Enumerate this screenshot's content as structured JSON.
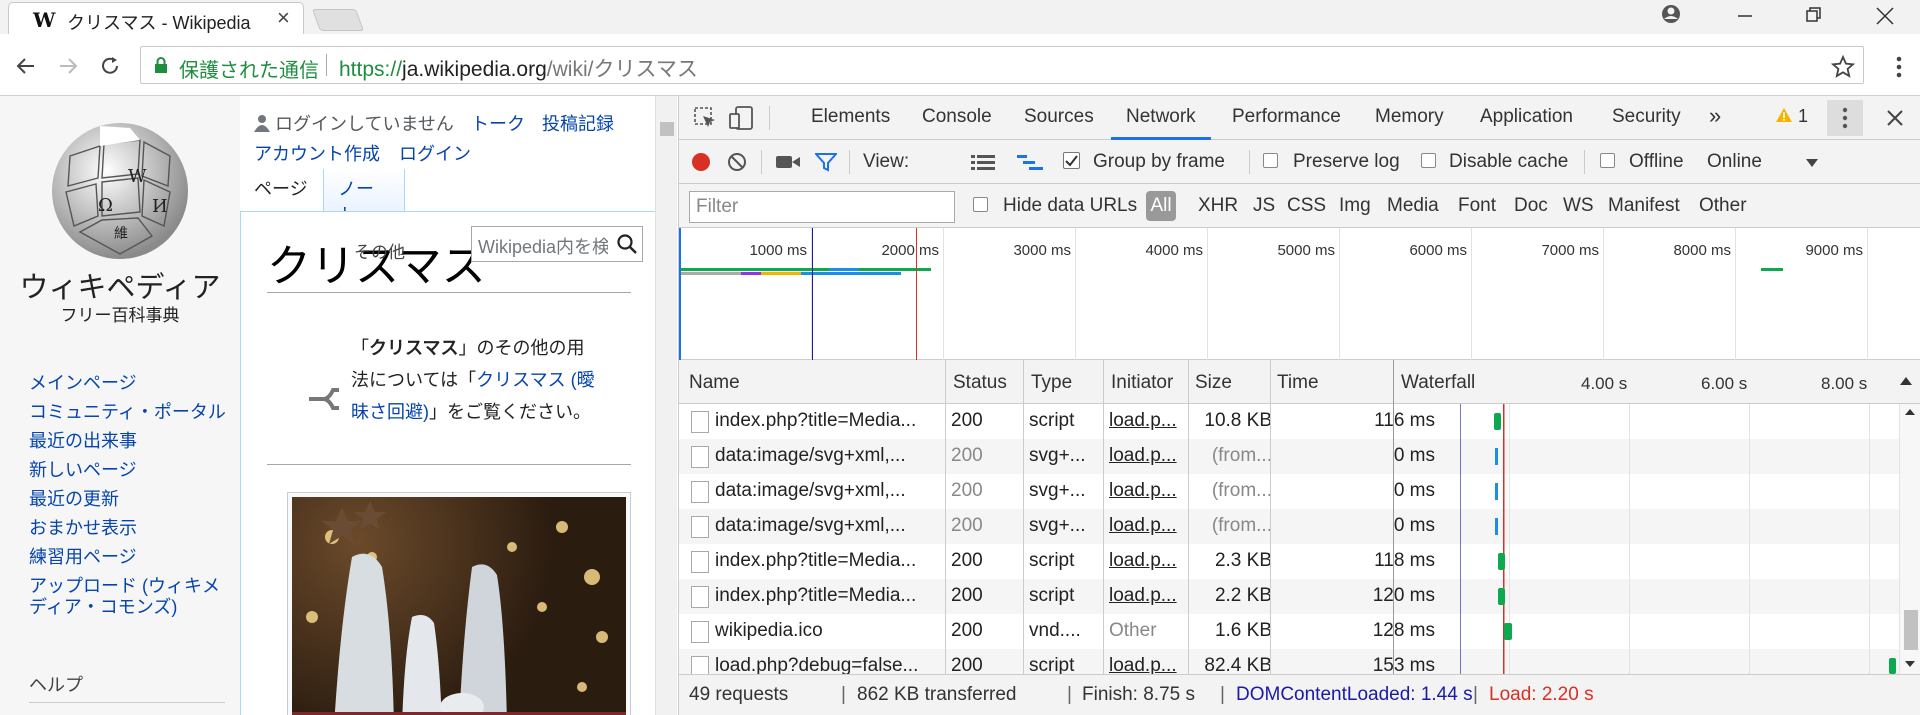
{
  "browser": {
    "tab_title": "クリスマス - Wikipedia",
    "tab_favicon": "W",
    "secure_label": "保護された通信",
    "url_scheme": "https://",
    "url_host": "ja.wikipedia.org",
    "url_path": "/wiki/クリスマス"
  },
  "wiki": {
    "site_name": "ウィキペディア",
    "tagline": "フリー百科事典",
    "not_logged_in": "ログインしていません",
    "talk": "トーク",
    "contributions": "投稿記録",
    "create_account": "アカウント作成",
    "login": "ログイン",
    "tab_page": "ページ",
    "tab_note": "ノート",
    "other": "その他",
    "search_placeholder": "Wikipedia内を検索",
    "page_title": "クリスマス",
    "hatnote_pre": "「",
    "hatnote_bold": "クリスマス",
    "hatnote_mid": "」のその他の用法については「",
    "hatnote_link": "クリスマス (曖昧さ回避)",
    "hatnote_post": "」をご覧ください。",
    "nav": [
      "メインページ",
      "コミュニティ・ポータル",
      "最近の出来事",
      "新しいページ",
      "最近の更新",
      "おまかせ表示",
      "練習用ページ",
      "アップロード (ウィキメディア・コモンズ)"
    ],
    "help_heading": "ヘルプ"
  },
  "devtools": {
    "tabs": [
      "Elements",
      "Console",
      "Sources",
      "Network",
      "Performance",
      "Memory",
      "Application",
      "Security"
    ],
    "active_tab": "Network",
    "more": "»",
    "warning_count": "1",
    "view_label": "View:",
    "group_by_frame": "Group by frame",
    "preserve_log": "Preserve log",
    "disable_cache": "Disable cache",
    "offline": "Offline",
    "throttle": "Online",
    "filter_placeholder": "Filter",
    "hide_data_urls": "Hide data URLs",
    "filter_types": [
      "All",
      "XHR",
      "JS",
      "CSS",
      "Img",
      "Media",
      "Font",
      "Doc",
      "WS",
      "Manifest",
      "Other"
    ],
    "overview_ticks": [
      "1000 ms",
      "2000 ms",
      "3000 ms",
      "4000 ms",
      "5000 ms",
      "6000 ms",
      "7000 ms",
      "8000 ms",
      "9000 ms"
    ],
    "columns": [
      "Name",
      "Status",
      "Type",
      "Initiator",
      "Size",
      "Time",
      "Waterfall"
    ],
    "waterfall_ticks": [
      "4.00 s",
      "6.00 s",
      "8.00 s"
    ],
    "rows": [
      {
        "name": "index.php?title=Media...",
        "status": "200",
        "type": "script",
        "initiator": "load.p...",
        "size": "10.8 KB",
        "time": "116 ms"
      },
      {
        "name": "data:image/svg+xml,...",
        "status": "200",
        "type": "svg+...",
        "initiator": "load.p...",
        "size": "(from...",
        "time": "0 ms"
      },
      {
        "name": "data:image/svg+xml,...",
        "status": "200",
        "type": "svg+...",
        "initiator": "load.p...",
        "size": "(from...",
        "time": "0 ms"
      },
      {
        "name": "data:image/svg+xml,...",
        "status": "200",
        "type": "svg+...",
        "initiator": "load.p...",
        "size": "(from...",
        "time": "0 ms"
      },
      {
        "name": "index.php?title=Media...",
        "status": "200",
        "type": "script",
        "initiator": "load.p...",
        "size": "2.3 KB",
        "time": "118 ms"
      },
      {
        "name": "index.php?title=Media...",
        "status": "200",
        "type": "script",
        "initiator": "load.p...",
        "size": "2.2 KB",
        "time": "120 ms"
      },
      {
        "name": "wikipedia.ico",
        "status": "200",
        "type": "vnd....",
        "initiator": "Other",
        "size": "1.6 KB",
        "time": "128 ms"
      },
      {
        "name": "load.php?debug=false...",
        "status": "200",
        "type": "script",
        "initiator": "load.p...",
        "size": "82.4 KB",
        "time": "153 ms"
      }
    ],
    "status": {
      "requests": "49 requests",
      "transferred": "862 KB transferred",
      "finish": "Finish: 8.75 s",
      "dcl": "DOMContentLoaded: 1.44 s",
      "load": "Load: 2.20 s"
    },
    "colors": {
      "accent": "#1a73e8",
      "dcl": "#1a1aa6",
      "load": "#d93025",
      "bar_green": "#0ca94f",
      "bar_blue": "#1a8fe8"
    }
  }
}
